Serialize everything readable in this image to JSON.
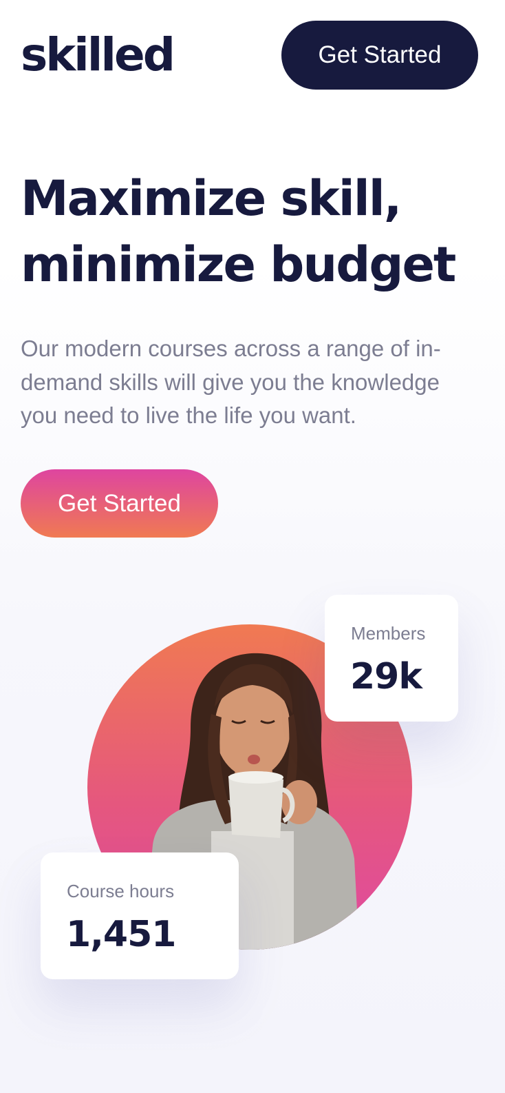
{
  "header": {
    "logo": "skilled",
    "cta_label": "Get Started"
  },
  "hero": {
    "title_line1": "Maximize skill,",
    "title_line2": "minimize budget",
    "description": "Our modern courses across a range of in-demand skills will give you the knowledge you need to live the life you want.",
    "cta_label": "Get Started"
  },
  "stats": {
    "members": {
      "label": "Members",
      "value": "29k"
    },
    "course_hours": {
      "label": "Course hours",
      "value": "1,451"
    }
  },
  "colors": {
    "navy": "#171a3e",
    "gray_text": "#7c7d91",
    "gradient_top": "#de45a0",
    "gradient_bottom": "#f07a52",
    "circle_top": "#f07a52",
    "circle_bottom": "#df4aa1"
  }
}
